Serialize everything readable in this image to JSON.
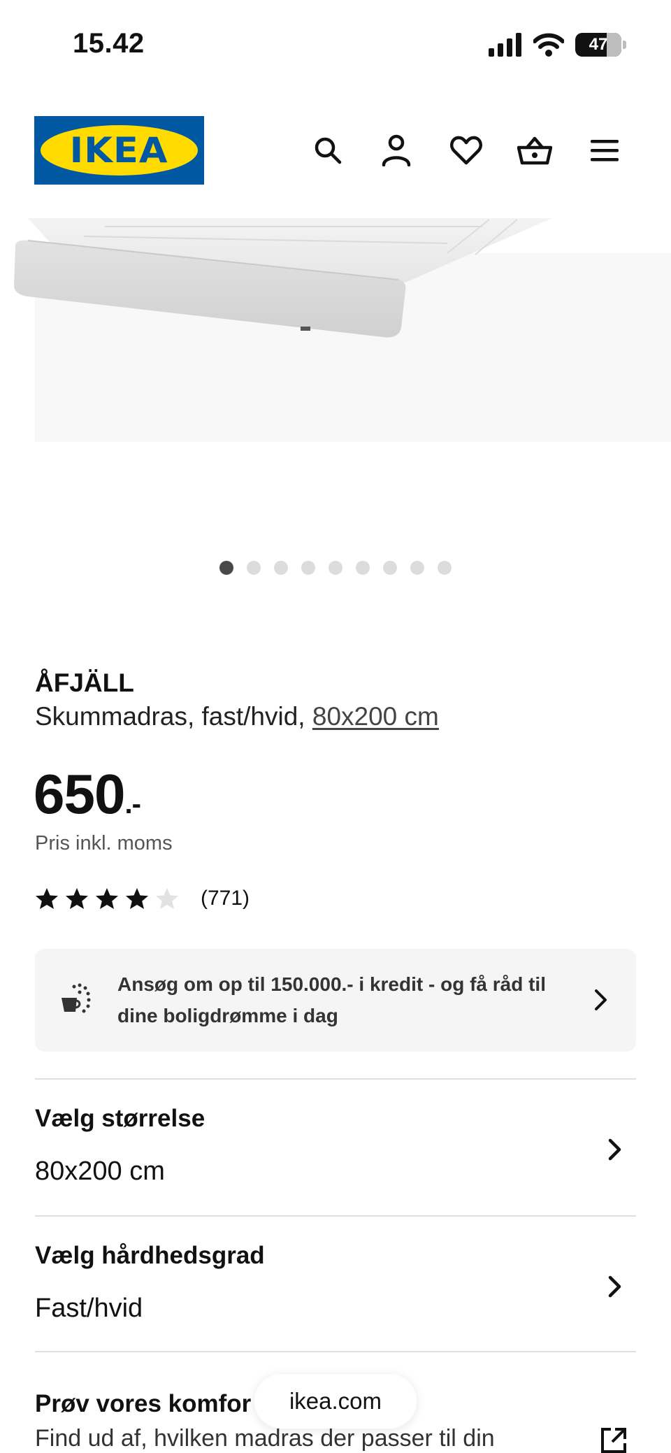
{
  "status_bar": {
    "time": "15.42",
    "battery_level": "47"
  },
  "header": {
    "logo_text": "IKEA",
    "icons": [
      "search-icon",
      "account-icon",
      "favorites-icon",
      "basket-icon",
      "menu-icon"
    ],
    "colors": {
      "logo_blue": "#0058a3",
      "logo_yellow": "#ffdb00"
    }
  },
  "gallery": {
    "image_count": 9,
    "active_index": 0
  },
  "product": {
    "name": "ÅFJÄLL",
    "description_prefix": "Skummadras, fast/hvid, ",
    "size_link": "80x200 cm",
    "price_main": "650",
    "price_suffix": ".-",
    "price_note": "Pris inkl. moms",
    "rating_value": 4,
    "rating_max": 5,
    "rating_count": "(771)"
  },
  "credit_banner": {
    "text": "Ansøg om op til 150.000.- i kredit - og få råd til dine boligdrømme i dag"
  },
  "options": [
    {
      "title": "Vælg størrelse",
      "value": "80x200 cm"
    },
    {
      "title": "Vælg hårdhedsgrad",
      "value": "Fast/hvid"
    }
  ],
  "comfort": {
    "title": "Prøv vores komfor",
    "description": "Find ud af, hvilken madras der passer til din"
  },
  "browser": {
    "url": "ikea.com"
  }
}
